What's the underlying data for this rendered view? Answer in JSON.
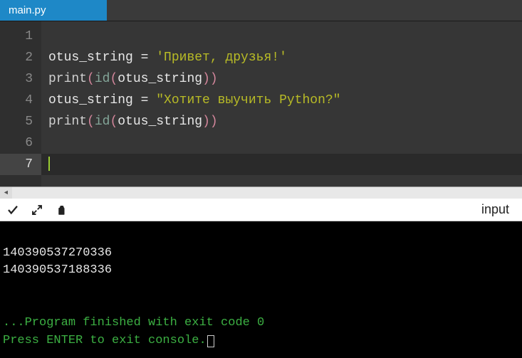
{
  "tab": {
    "filename": "main.py"
  },
  "editor": {
    "line_numbers": [
      "1",
      "2",
      "3",
      "4",
      "5",
      "6",
      "7"
    ],
    "active_line": 7,
    "lines": {
      "l2_id": "otus_string",
      "l2_op": " = ",
      "l2_str": "'Привет, друзья!'",
      "l3_fn": "print",
      "l3_p1": "(",
      "l3_builtin": "id",
      "l3_p2": "(",
      "l3_id": "otus_string",
      "l3_p3": ")",
      "l3_p4": ")",
      "l4_id": "otus_string",
      "l4_op": " = ",
      "l4_str": "\"Хотите выучить Python?\"",
      "l5_fn": "print",
      "l5_p1": "(",
      "l5_builtin": "id",
      "l5_p2": "(",
      "l5_id": "otus_string",
      "l5_p3": ")",
      "l5_p4": ")"
    }
  },
  "toolbar": {
    "input_label": "input"
  },
  "console": {
    "out1": "140390537270336",
    "out2": "140390537188336",
    "status": "...Program finished with exit code 0",
    "prompt": "Press ENTER to exit console."
  }
}
